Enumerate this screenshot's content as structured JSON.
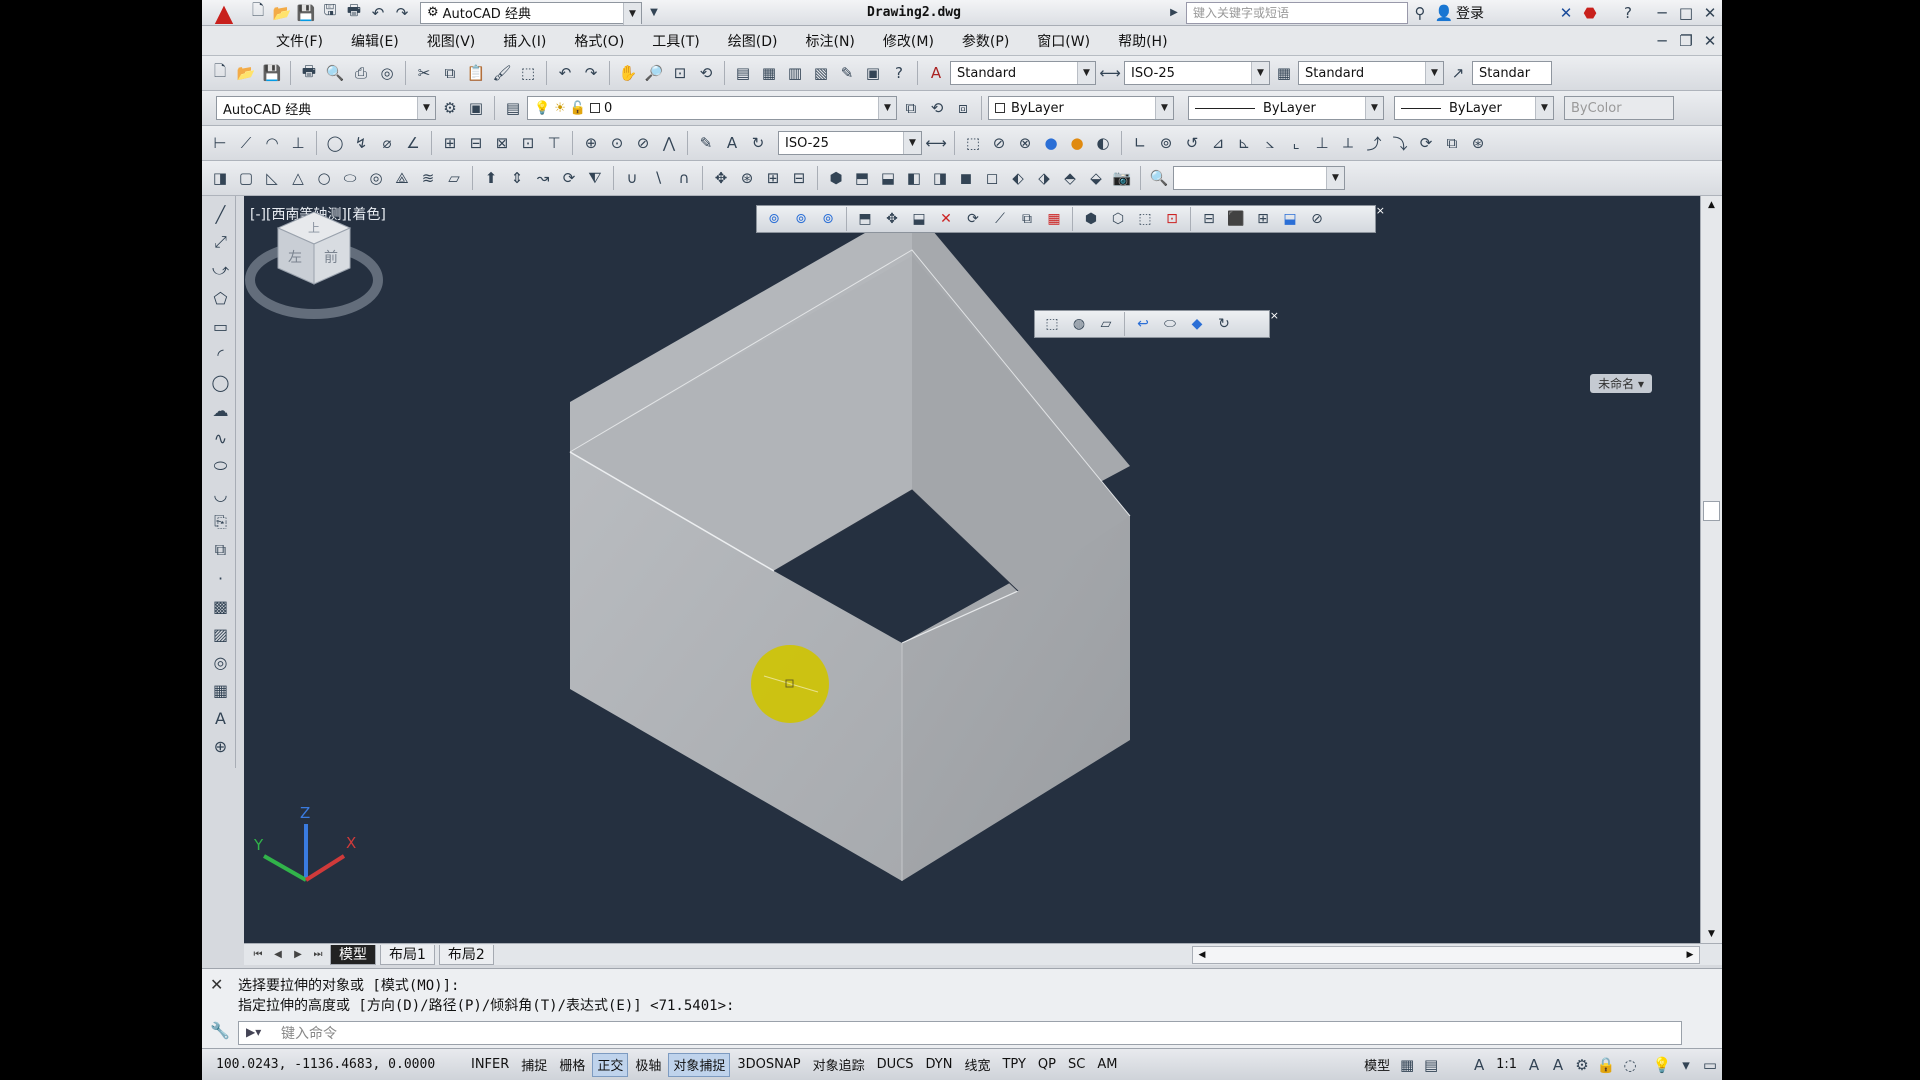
{
  "titlebar": {
    "workspace": "AutoCAD 经典",
    "doc_title": "Drawing2.dwg",
    "search_placeholder": "键入关键字或短语",
    "login": "登录"
  },
  "menu": [
    "文件(F)",
    "编辑(E)",
    "视图(V)",
    "插入(I)",
    "格式(O)",
    "工具(T)",
    "绘图(D)",
    "标注(N)",
    "修改(M)",
    "参数(P)",
    "窗口(W)",
    "帮助(H)"
  ],
  "styles": {
    "text_style": "Standard",
    "dim_style": "ISO-25",
    "table_style": "Standard",
    "mleader_style": "Standar"
  },
  "layers": {
    "workspace_combo": "AutoCAD 经典",
    "current_layer": "0",
    "color": "ByLayer",
    "linetype": "ByLayer",
    "lineweight": "ByLayer",
    "plotstyle": "ByColor"
  },
  "dim_toolbar": {
    "dim_style": "ISO-25"
  },
  "viewport": {
    "label": "[-][西南等轴测][着色]",
    "cube_top": "上",
    "cube_left": "左",
    "cube_front": "前",
    "ucs_name": "未命名",
    "axes": {
      "x": "X",
      "y": "Y",
      "z": "Z"
    }
  },
  "layout_tabs": [
    "模型",
    "布局1",
    "布局2"
  ],
  "command": {
    "line1": "选择要拉伸的对象或 [模式(MO)]:",
    "line2": "指定拉伸的高度或 [方向(D)/路径(P)/倾斜角(T)/表达式(E)] <71.5401>:",
    "input_placeholder": "键入命令"
  },
  "status": {
    "coords": "100.0243, -1136.4683, 0.0000",
    "buttons": [
      {
        "label": "INFER",
        "on": false
      },
      {
        "label": "捕捉",
        "on": false
      },
      {
        "label": "栅格",
        "on": false
      },
      {
        "label": "正交",
        "on": true
      },
      {
        "label": "极轴",
        "on": false
      },
      {
        "label": "对象捕捉",
        "on": true
      },
      {
        "label": "3DOSNAP",
        "on": false
      },
      {
        "label": "对象追踪",
        "on": false
      },
      {
        "label": "DUCS",
        "on": false
      },
      {
        "label": "DYN",
        "on": false
      },
      {
        "label": "线宽",
        "on": false
      },
      {
        "label": "TPY",
        "on": false
      },
      {
        "label": "QP",
        "on": false
      },
      {
        "label": "SC",
        "on": false
      },
      {
        "label": "AM",
        "on": false
      }
    ],
    "model_label": "模型",
    "scale": "1:1"
  },
  "colors": {
    "viewport_bg": "#253040",
    "accent": "#c8201c"
  }
}
